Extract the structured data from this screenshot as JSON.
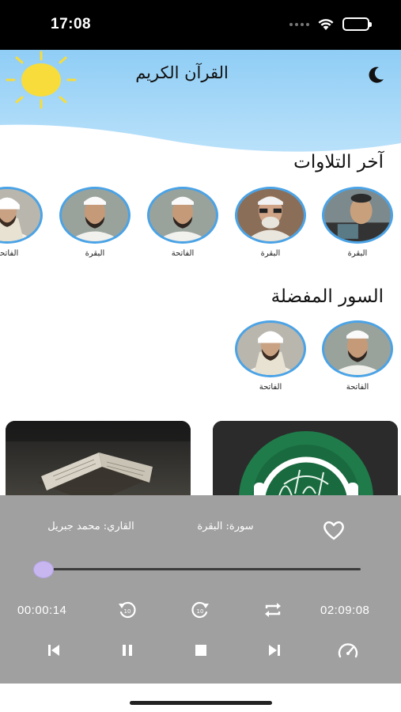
{
  "status_bar": {
    "time": "17:08"
  },
  "header": {
    "title": "القرآن الكريم",
    "sky_color": "#9fd5f6",
    "sun_color": "#f7dc3c"
  },
  "recent": {
    "title": "آخر التلاوات",
    "items": [
      {
        "surah": "البقرة",
        "portrait": "bearded-man-dark"
      },
      {
        "surah": "البقرة",
        "portrait": "elder-glasses"
      },
      {
        "surah": "الفاتحة",
        "portrait": "young-imam"
      },
      {
        "surah": "البقرة",
        "portrait": "young-imam"
      },
      {
        "surah": "الفاتحة",
        "portrait": "imam-white"
      }
    ]
  },
  "favorites": {
    "title": "السور المفضلة",
    "items": [
      {
        "surah": "الفاتحة",
        "portrait": "young-imam"
      },
      {
        "surah": "الفاتحة",
        "portrait": "imam-white"
      }
    ]
  },
  "player": {
    "surah_text": "سورة: البقرة",
    "reciter_text": "القاري: محمد جبريل",
    "elapsed": "00:00:14",
    "total": "02:09:08",
    "progress": 0.0018,
    "background": "#a0a0a0",
    "thumb_color": "#c7b6ef"
  }
}
